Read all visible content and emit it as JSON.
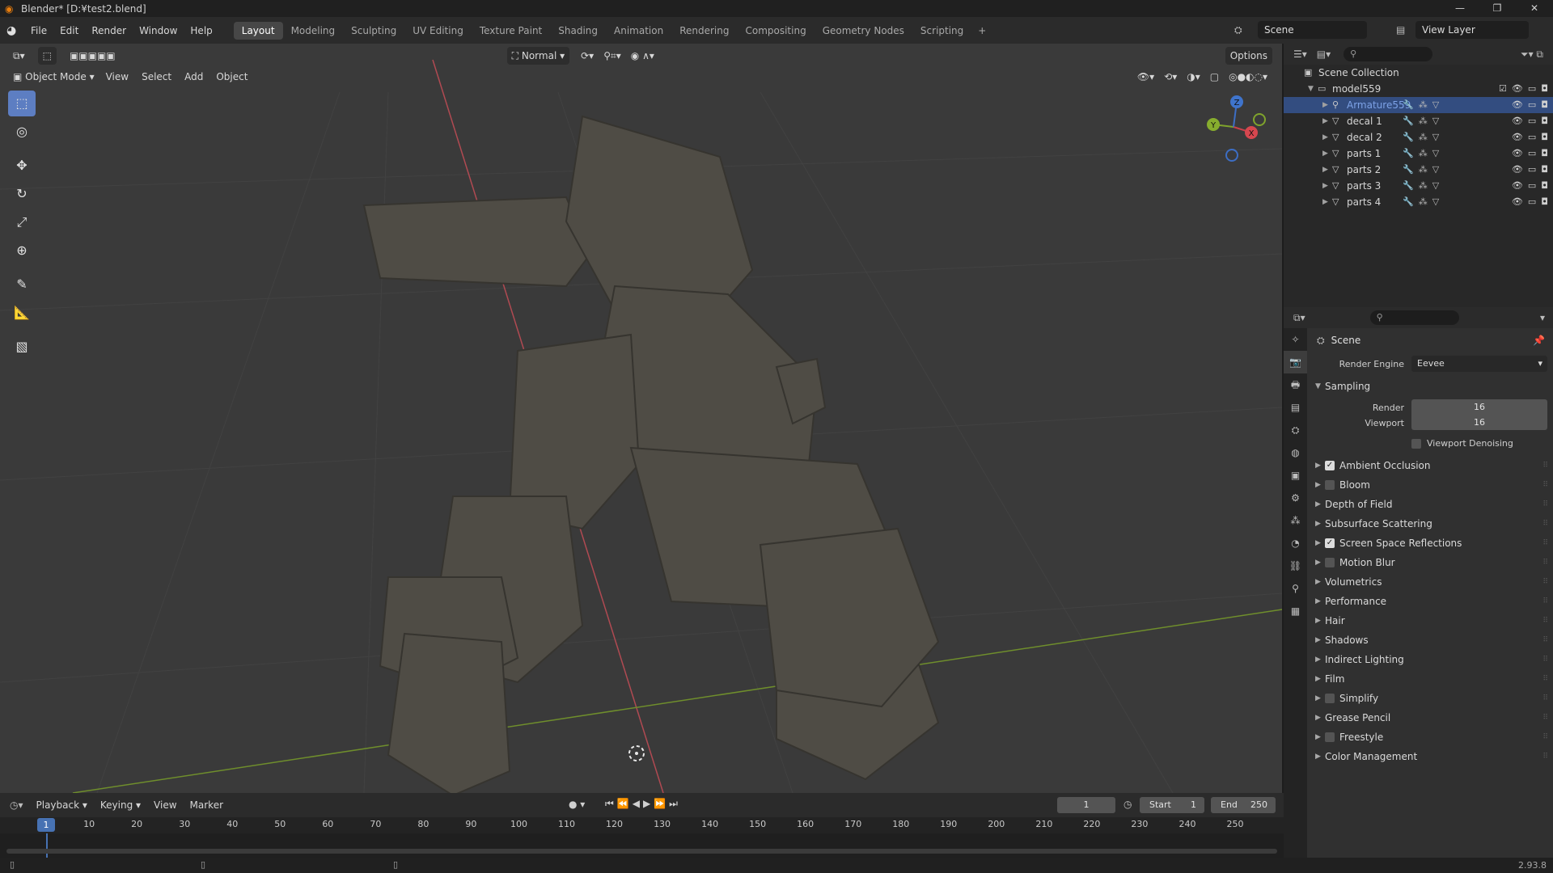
{
  "titlebar": {
    "title": "Blender* [D:¥test2.blend]",
    "min": "—",
    "max": "❐",
    "close": "✕"
  },
  "menubar": {
    "menus": [
      "File",
      "Edit",
      "Render",
      "Window",
      "Help"
    ],
    "workspaces": [
      "Layout",
      "Modeling",
      "Sculpting",
      "UV Editing",
      "Texture Paint",
      "Shading",
      "Animation",
      "Rendering",
      "Compositing",
      "Geometry Nodes",
      "Scripting"
    ],
    "active_workspace": "Layout",
    "add_tab": "+",
    "scene": "Scene",
    "view_layer": "View Layer"
  },
  "viewport": {
    "mode": "Object Mode",
    "menus": [
      "View",
      "Select",
      "Add",
      "Object"
    ],
    "orientation": "Normal",
    "options": "Options",
    "gizmo": {
      "x": "X",
      "y": "Y",
      "z": "Z"
    }
  },
  "outliner": {
    "root": "Scene Collection",
    "collection": "model559",
    "items": [
      {
        "label": "Armature559",
        "selected": true
      },
      {
        "label": "decal 1",
        "selected": false
      },
      {
        "label": "decal 2",
        "selected": false
      },
      {
        "label": "parts 1",
        "selected": false
      },
      {
        "label": "parts 2",
        "selected": false
      },
      {
        "label": "parts 3",
        "selected": false
      },
      {
        "label": "parts 4",
        "selected": false
      }
    ]
  },
  "properties": {
    "context": "Scene",
    "render_engine_label": "Render Engine",
    "render_engine": "Eevee",
    "sampling": {
      "title": "Sampling",
      "render_label": "Render",
      "render": "16",
      "viewport_label": "Viewport",
      "viewport": "16",
      "denoise_label": "Viewport Denoising"
    },
    "sections": [
      {
        "label": "Ambient Occlusion",
        "checkbox": true,
        "checked": true
      },
      {
        "label": "Bloom",
        "checkbox": true,
        "checked": false
      },
      {
        "label": "Depth of Field",
        "checkbox": false,
        "checked": false
      },
      {
        "label": "Subsurface Scattering",
        "checkbox": false,
        "checked": false
      },
      {
        "label": "Screen Space Reflections",
        "checkbox": true,
        "checked": true
      },
      {
        "label": "Motion Blur",
        "checkbox": true,
        "checked": false
      },
      {
        "label": "Volumetrics",
        "checkbox": false,
        "checked": false
      },
      {
        "label": "Performance",
        "checkbox": false,
        "checked": false
      },
      {
        "label": "Hair",
        "checkbox": false,
        "checked": false
      },
      {
        "label": "Shadows",
        "checkbox": false,
        "checked": false
      },
      {
        "label": "Indirect Lighting",
        "checkbox": false,
        "checked": false
      },
      {
        "label": "Film",
        "checkbox": false,
        "checked": false
      },
      {
        "label": "Simplify",
        "checkbox": true,
        "checked": false
      },
      {
        "label": "Grease Pencil",
        "checkbox": false,
        "checked": false
      },
      {
        "label": "Freestyle",
        "checkbox": true,
        "checked": false
      },
      {
        "label": "Color Management",
        "checkbox": false,
        "checked": false
      }
    ]
  },
  "timeline": {
    "menus": [
      "Playback",
      "Keying",
      "View",
      "Marker"
    ],
    "current_frame": "1",
    "start_label": "Start",
    "start": "1",
    "end_label": "End",
    "end": "250",
    "ruler": [
      "10",
      "20",
      "30",
      "40",
      "50",
      "60",
      "70",
      "80",
      "90",
      "100",
      "110",
      "120",
      "130",
      "140",
      "150",
      "160",
      "170",
      "180",
      "190",
      "200",
      "210",
      "220",
      "230",
      "240",
      "250"
    ]
  },
  "statusbar": {
    "version": "2.93.8"
  }
}
